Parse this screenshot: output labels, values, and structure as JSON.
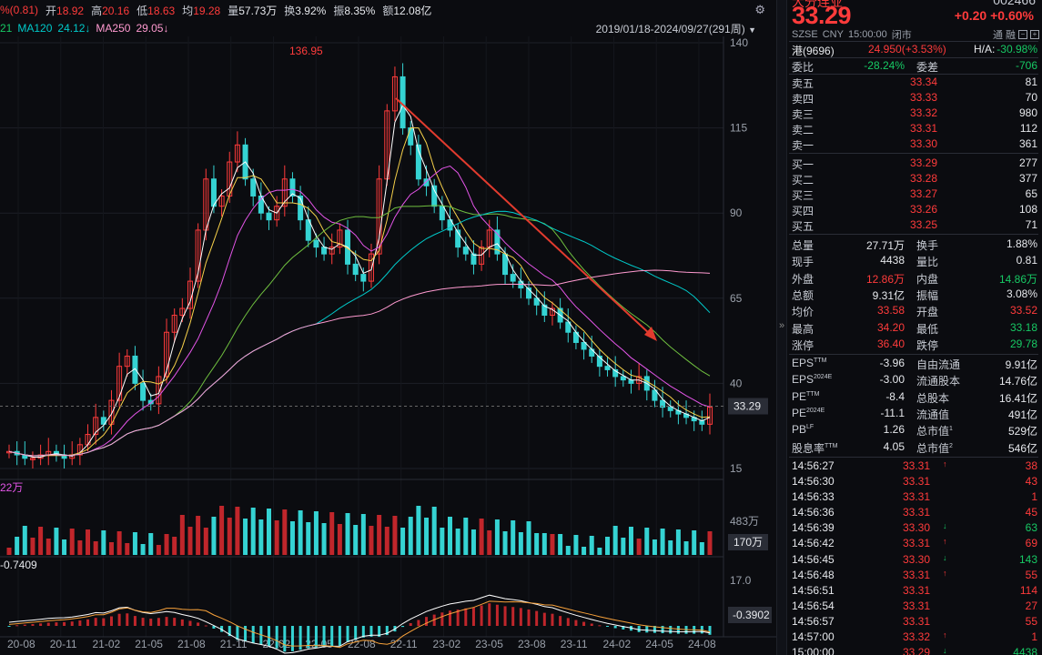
{
  "topbar": {
    "prev_close_label": "%(0.81)",
    "open_label": "开",
    "open_val": "18.92",
    "high_label": "高",
    "high_val": "20.16",
    "low_label": "低",
    "low_val": "18.63",
    "avg_label": "均",
    "avg_val": "19.28",
    "vol_label": "量",
    "vol_val": "57.73万",
    "turn_label": "换",
    "turn_val": "3.92%",
    "amp_label": "振",
    "amp_val": "8.35%",
    "amt_label": "额",
    "amt_val": "12.08亿"
  },
  "ma_bar": {
    "ma_prefix": "21",
    "ma120_label": "MA120",
    "ma120_val": "24.12↓",
    "ma250_label": "MA250",
    "ma250_val": "29.05↓",
    "date_range": "2019/01/18-2024/09/27(291周)"
  },
  "chart_data": {
    "type": "candlestick",
    "price_axis": [
      140,
      115,
      90,
      65,
      40,
      15
    ],
    "current_price_tag": "33.29",
    "peak_label": "136.95",
    "volume_axis": [
      "483万",
      "170万"
    ],
    "volume_label": "22万",
    "macd_axis": [
      "17.0",
      "-0.3902"
    ],
    "macd_label": "-0.7409",
    "x_labels": [
      "20-08",
      "20-11",
      "21-02",
      "21-05",
      "21-08",
      "21-11",
      "22-02",
      "22-05",
      "22-08",
      "22-11",
      "23-02",
      "23-05",
      "23-08",
      "23-11",
      "24-02",
      "24-05",
      "24-08"
    ],
    "closes": [
      20,
      19,
      18,
      18,
      19,
      20,
      19,
      18,
      19,
      22,
      25,
      30,
      28,
      35,
      45,
      48,
      40,
      35,
      34,
      42,
      55,
      60,
      62,
      70,
      85,
      100,
      92,
      95,
      105,
      110,
      100,
      95,
      90,
      88,
      92,
      100,
      95,
      88,
      82,
      80,
      78,
      80,
      85,
      75,
      72,
      70,
      78,
      100,
      120,
      130,
      115,
      110,
      100,
      98,
      92,
      88,
      85,
      80,
      78,
      75,
      80,
      85,
      78,
      72,
      70,
      68,
      65,
      63,
      60,
      62,
      58,
      55,
      52,
      50,
      48,
      45,
      44,
      42,
      41,
      40,
      42,
      38,
      35,
      33,
      32,
      31,
      30,
      29,
      28,
      33
    ],
    "ma_colors": [
      "#ffffff",
      "#f7d14a",
      "#e455e8",
      "#6fbf3f",
      "#00c9c9",
      "#ff9ad0"
    ]
  },
  "panel": {
    "name_cut": "大分连业",
    "code_cut": "002466",
    "price": "33.29",
    "change": "+0.20",
    "change_pct": "+0.60%",
    "market": "SZSE",
    "currency": "CNY",
    "time": "15:00:00",
    "status": "闭市",
    "icon_a": "通",
    "icon_b": "融",
    "hk_label": "港(9696)",
    "hk_val": "24.950(+3.53%)",
    "ha_label": "H/A:",
    "ha_val": "-30.98%",
    "wb_label": "委比",
    "wb_val": "-28.24%",
    "wc_label": "委差",
    "wc_val": "-706",
    "asks": [
      {
        "label": "卖五",
        "price": "33.34",
        "vol": "81"
      },
      {
        "label": "卖四",
        "price": "33.33",
        "vol": "70"
      },
      {
        "label": "卖三",
        "price": "33.32",
        "vol": "980"
      },
      {
        "label": "卖二",
        "price": "33.31",
        "vol": "112"
      },
      {
        "label": "卖一",
        "price": "33.30",
        "vol": "361"
      }
    ],
    "bids": [
      {
        "label": "买一",
        "price": "33.29",
        "vol": "277"
      },
      {
        "label": "买二",
        "price": "33.28",
        "vol": "377"
      },
      {
        "label": "买三",
        "price": "33.27",
        "vol": "65"
      },
      {
        "label": "买四",
        "price": "33.26",
        "vol": "108"
      },
      {
        "label": "买五",
        "price": "33.25",
        "vol": "71"
      }
    ],
    "stats": [
      {
        "l1": "总量",
        "v1": "27.71万",
        "c1": "white",
        "l2": "换手",
        "v2": "1.88%",
        "c2": "white"
      },
      {
        "l1": "现手",
        "v1": "4438",
        "c1": "white",
        "l2": "量比",
        "v2": "0.81",
        "c2": "white"
      },
      {
        "l1": "外盘",
        "v1": "12.86万",
        "c1": "up",
        "l2": "内盘",
        "v2": "14.86万",
        "c2": "dn"
      },
      {
        "l1": "总额",
        "v1": "9.31亿",
        "c1": "white",
        "l2": "振幅",
        "v2": "3.08%",
        "c2": "white"
      },
      {
        "l1": "均价",
        "v1": "33.58",
        "c1": "up",
        "l2": "开盘",
        "v2": "33.52",
        "c2": "up"
      },
      {
        "l1": "最高",
        "v1": "34.20",
        "c1": "up",
        "l2": "最低",
        "v2": "33.18",
        "c2": "dn"
      },
      {
        "l1": "涨停",
        "v1": "36.40",
        "c1": "up",
        "l2": "跌停",
        "v2": "29.78",
        "c2": "dn"
      }
    ],
    "fund": [
      {
        "l1": "EPS",
        "s1": "TTM",
        "v1": "-3.96",
        "l2": "自由流通",
        "s2": "",
        "v2": "9.91亿"
      },
      {
        "l1": "EPS",
        "s1": "2024E",
        "v1": "-3.00",
        "l2": "流通股本",
        "s2": "",
        "v2": "14.76亿"
      },
      {
        "l1": "PE",
        "s1": "TTM",
        "v1": "-8.4",
        "l2": "总股本",
        "s2": "",
        "v2": "16.41亿"
      },
      {
        "l1": "PE",
        "s1": "2024E",
        "v1": "-11.1",
        "l2": "流通值",
        "s2": "",
        "v2": "491亿"
      },
      {
        "l1": "PB",
        "s1": "LF",
        "v1": "1.26",
        "l2": "总市值",
        "s2": "1",
        "v2": "529亿"
      },
      {
        "l1": "股息率",
        "s1": "TTM",
        "v1": "4.05",
        "l2": "总市值",
        "s2": "2",
        "v2": "546亿"
      }
    ],
    "ticks": [
      {
        "time": "14:56:27",
        "price": "33.31",
        "dir": "up",
        "vol": "38"
      },
      {
        "time": "14:56:30",
        "price": "33.31",
        "dir": "",
        "vol": "43"
      },
      {
        "time": "14:56:33",
        "price": "33.31",
        "dir": "",
        "vol": "1"
      },
      {
        "time": "14:56:36",
        "price": "33.31",
        "dir": "",
        "vol": "45"
      },
      {
        "time": "14:56:39",
        "price": "33.30",
        "dir": "dn",
        "vol": "63"
      },
      {
        "time": "14:56:42",
        "price": "33.31",
        "dir": "up",
        "vol": "69"
      },
      {
        "time": "14:56:45",
        "price": "33.30",
        "dir": "dn",
        "vol": "143"
      },
      {
        "time": "14:56:48",
        "price": "33.31",
        "dir": "up",
        "vol": "55"
      },
      {
        "time": "14:56:51",
        "price": "33.31",
        "dir": "",
        "vol": "114"
      },
      {
        "time": "14:56:54",
        "price": "33.31",
        "dir": "",
        "vol": "27"
      },
      {
        "time": "14:56:57",
        "price": "33.31",
        "dir": "",
        "vol": "55"
      },
      {
        "time": "14:57:00",
        "price": "33.32",
        "dir": "up",
        "vol": "1"
      },
      {
        "time": "15:00:00",
        "price": "33.29",
        "dir": "dn",
        "vol": "4438"
      }
    ]
  }
}
